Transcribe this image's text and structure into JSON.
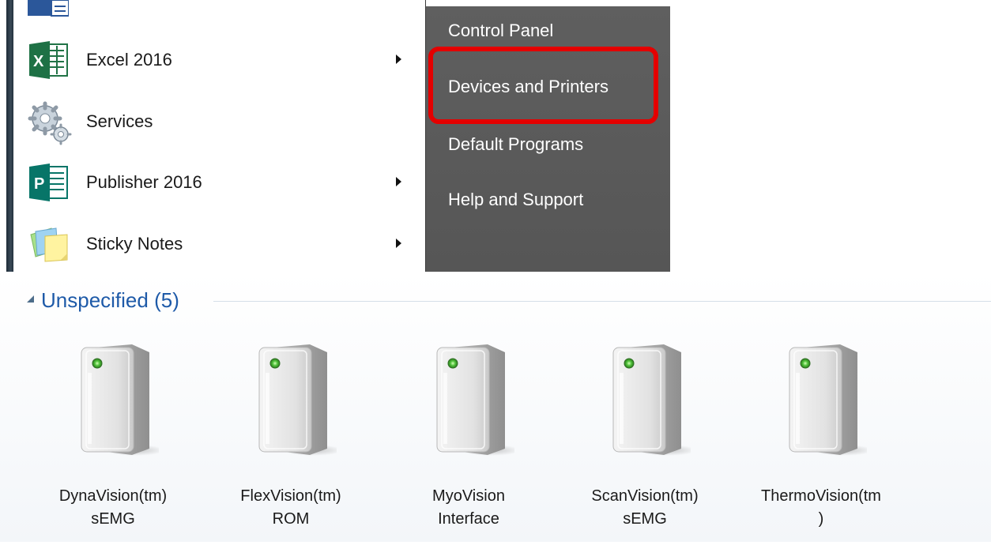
{
  "start_menu": {
    "programs": [
      {
        "label": "Excel 2016",
        "icon": "excel-icon",
        "has_submenu": true
      },
      {
        "label": "Services",
        "icon": "services-gears-icon",
        "has_submenu": false
      },
      {
        "label": "Publisher 2016",
        "icon": "publisher-icon",
        "has_submenu": true
      },
      {
        "label": "Sticky Notes",
        "icon": "sticky-notes-icon",
        "has_submenu": true
      }
    ],
    "right_pane": [
      {
        "label": "Control Panel"
      },
      {
        "label": "Devices and Printers",
        "highlighted": true
      },
      {
        "label": "Default Programs"
      },
      {
        "label": "Help and Support"
      }
    ],
    "highlight_color": "#e40000"
  },
  "devices": {
    "group_title": "Unspecified (5)",
    "items": [
      {
        "line1": "DynaVision(tm)",
        "line2": "sEMG",
        "icon": "generic-device-tower-icon"
      },
      {
        "line1": "FlexVision(tm)",
        "line2": "ROM",
        "icon": "generic-device-tower-icon"
      },
      {
        "line1": "MyoVision",
        "line2": "Interface",
        "icon": "generic-device-tower-icon"
      },
      {
        "line1": "ScanVision(tm)",
        "line2": "sEMG",
        "icon": "generic-device-tower-icon"
      },
      {
        "line1": "ThermoVision(tm",
        "line2": ")",
        "icon": "generic-device-tower-icon"
      }
    ],
    "status_light_color": "#4fc23a",
    "group_title_color": "#1e5aa8"
  }
}
